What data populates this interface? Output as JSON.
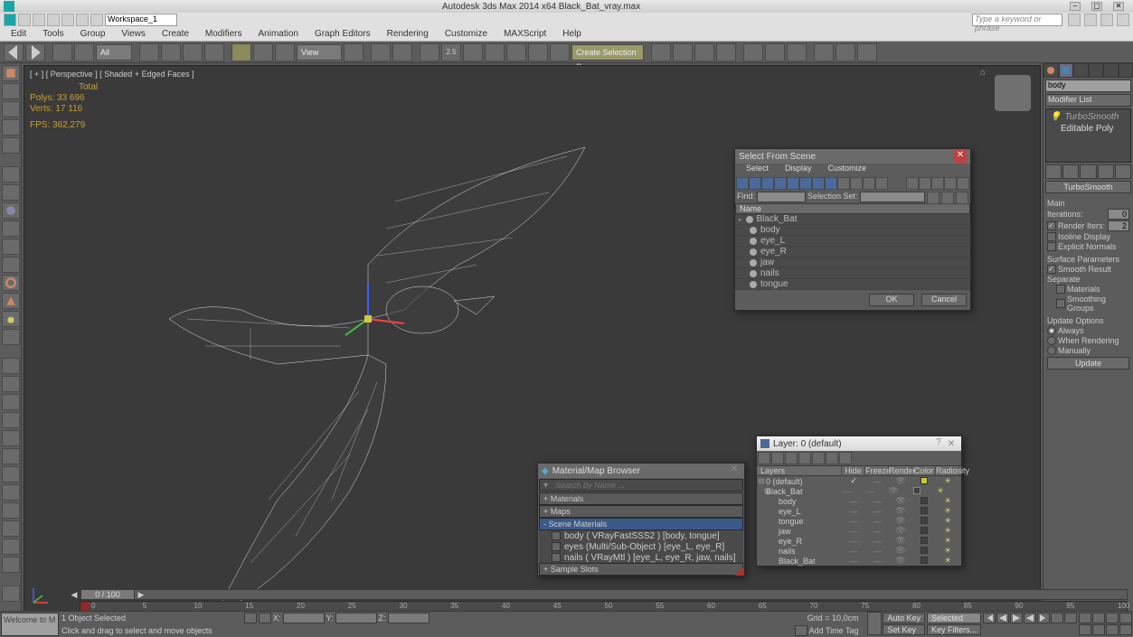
{
  "app": {
    "title": "Autodesk 3ds Max  2014 x64    Black_Bat_vray.max",
    "workspace": "Workspace_1",
    "search_placeholder": "Type a keyword or phrase"
  },
  "menu": [
    "Edit",
    "Tools",
    "Group",
    "Views",
    "Create",
    "Modifiers",
    "Animation",
    "Graph Editors",
    "Rendering",
    "Customize",
    "MAXScript",
    "Help"
  ],
  "toolbar": {
    "all_dd": "All",
    "view_dd": "View",
    "create_sel_dd": "Create Selection S...",
    "snap_val": "2.5"
  },
  "viewport": {
    "label": "[ + ] [ Perspective ] [ Shaded + Edged Faces ]",
    "stats_hdr": "Total",
    "polys": "Polys:    33 696",
    "verts": "Verts:    17 116",
    "fps": "FPS:      362,279"
  },
  "cmdpanel": {
    "object_name": "body",
    "modifier_list": "Modifier List",
    "stack": [
      {
        "name": "TurboSmooth",
        "italic": true
      },
      {
        "name": "Editable Poly",
        "italic": false
      }
    ],
    "rollout_name": "TurboSmooth",
    "main_hdr": "Main",
    "iterations_lbl": "Iterations:",
    "iterations_val": "0",
    "render_iters_lbl": "Render Iters:",
    "render_iters_val": "2",
    "isoline_lbl": "Isoline Display",
    "explicit_lbl": "Explicit Normals",
    "surf_params": "Surface Parameters",
    "smooth_result": "Smooth Result",
    "separate": "Separate",
    "materials": "Materials",
    "smoothing_groups": "Smoothing Groups",
    "update_options": "Update Options",
    "opt_always": "Always",
    "opt_render": "When Rendering",
    "opt_manual": "Manually",
    "update_btn": "Update"
  },
  "select_scene": {
    "title": "Select From Scene",
    "menus": [
      "Select",
      "Display",
      "Customize"
    ],
    "find_lbl": "Find:",
    "sel_set_lbl": "Selection Set:",
    "col_name": "Name",
    "items": [
      "Black_Bat",
      "body",
      "eye_L",
      "eye_R",
      "jaw",
      "nails",
      "tongue"
    ],
    "ok": "OK",
    "cancel": "Cancel"
  },
  "matbrowser": {
    "title": "Material/Map Browser",
    "search_ph": "Search by Name ...",
    "sec_materials": "+ Materials",
    "sec_maps": "+ Maps",
    "sec_scene": "- Scene Materials",
    "sec_samples": "+ Sample Slots",
    "items": [
      "body  ( VRayFastSSS2 )  [body, tongue]",
      "eyes  (Multi/Sub-Object )  [eye_L, eye_R]",
      "nails ( VRayMtl )  [eye_L, eye_R, jaw, nails]"
    ]
  },
  "layers": {
    "title": "Layer: 0 (default)",
    "cols": [
      "Layers",
      "Hide",
      "Freeze",
      "Render",
      "Color",
      "Radiosity"
    ],
    "rows": [
      {
        "name": "0 (default)",
        "indent": 0,
        "exp": "⊟",
        "hide": "✓",
        "color": "#c8c830"
      },
      {
        "name": "Black_Bat",
        "indent": 1,
        "exp": "⊟",
        "color": "#404040",
        "colbox": true
      },
      {
        "name": "body",
        "indent": 2,
        "color": "#404040"
      },
      {
        "name": "eye_L",
        "indent": 2,
        "color": "#404040"
      },
      {
        "name": "tongue",
        "indent": 2,
        "color": "#404040"
      },
      {
        "name": "jaw",
        "indent": 2,
        "color": "#404040"
      },
      {
        "name": "eye_R",
        "indent": 2,
        "color": "#404040"
      },
      {
        "name": "nails",
        "indent": 2,
        "color": "#404040"
      },
      {
        "name": "Black_Bat",
        "indent": 2,
        "color": "#404040"
      }
    ]
  },
  "timeline": {
    "pos": "0 / 100",
    "ticks": [
      "0",
      "5",
      "10",
      "15",
      "20",
      "25",
      "30",
      "35",
      "40",
      "45",
      "50",
      "55",
      "60",
      "65",
      "70",
      "75",
      "80",
      "85",
      "90",
      "95",
      "100"
    ]
  },
  "status": {
    "macro": "Welcome to M",
    "obj_sel": "1 Object Selected",
    "prompt": "Click and drag to select and move objects",
    "x": "X:",
    "y": "Y:",
    "z": "Z:",
    "grid": "Grid = 10,0cm",
    "addtime": "Add Time Tag",
    "autokey": "Auto Key",
    "setkey": "Set Key",
    "selected": "Selected",
    "keyfilters": "Key Filters..."
  }
}
